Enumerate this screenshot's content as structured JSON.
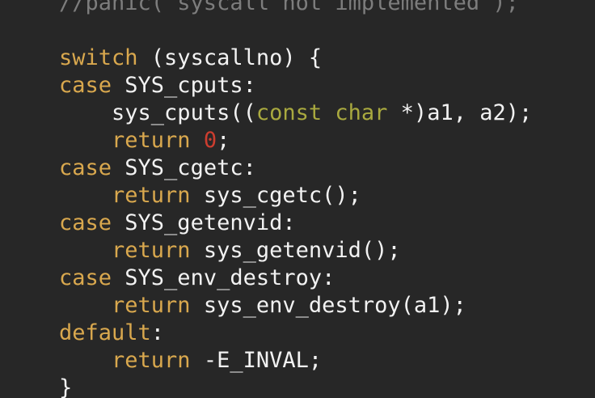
{
  "colors": {
    "background": "#272727",
    "keyword": "#d9a84e",
    "type": "#a9a93f",
    "number": "#cc3d2f",
    "comment": "#7d7d7d",
    "text": "#f2f2f2"
  },
  "code": {
    "lines": [
      {
        "indent": "",
        "tokens": [
          {
            "t": "cm",
            "v": "//panic(\"syscall not implemented\");"
          }
        ]
      },
      {
        "indent": "",
        "tokens": []
      },
      {
        "indent": "",
        "tokens": [
          {
            "t": "kw",
            "v": "switch"
          },
          {
            "t": "pl",
            "v": " (syscallno) {"
          }
        ]
      },
      {
        "indent": "",
        "tokens": [
          {
            "t": "kw",
            "v": "case"
          },
          {
            "t": "pl",
            "v": " SYS_cputs:"
          }
        ]
      },
      {
        "indent": "    ",
        "tokens": [
          {
            "t": "pl",
            "v": "sys_cputs(("
          },
          {
            "t": "type",
            "v": "const"
          },
          {
            "t": "pl",
            "v": " "
          },
          {
            "t": "type",
            "v": "char"
          },
          {
            "t": "pl",
            "v": " *)a1, a2);"
          }
        ]
      },
      {
        "indent": "    ",
        "tokens": [
          {
            "t": "kw",
            "v": "return"
          },
          {
            "t": "pl",
            "v": " "
          },
          {
            "t": "num",
            "v": "0"
          },
          {
            "t": "pl",
            "v": ";"
          }
        ]
      },
      {
        "indent": "",
        "tokens": [
          {
            "t": "kw",
            "v": "case"
          },
          {
            "t": "pl",
            "v": " SYS_cgetc:"
          }
        ]
      },
      {
        "indent": "    ",
        "tokens": [
          {
            "t": "kw",
            "v": "return"
          },
          {
            "t": "pl",
            "v": " sys_cgetc();"
          }
        ]
      },
      {
        "indent": "",
        "tokens": [
          {
            "t": "kw",
            "v": "case"
          },
          {
            "t": "pl",
            "v": " SYS_getenvid:"
          }
        ]
      },
      {
        "indent": "    ",
        "tokens": [
          {
            "t": "kw",
            "v": "return"
          },
          {
            "t": "pl",
            "v": " sys_getenvid();"
          }
        ]
      },
      {
        "indent": "",
        "tokens": [
          {
            "t": "kw",
            "v": "case"
          },
          {
            "t": "pl",
            "v": " SYS_env_destroy:"
          }
        ]
      },
      {
        "indent": "    ",
        "tokens": [
          {
            "t": "kw",
            "v": "return"
          },
          {
            "t": "pl",
            "v": " sys_env_destroy(a1);"
          }
        ]
      },
      {
        "indent": "",
        "tokens": [
          {
            "t": "kw",
            "v": "default"
          },
          {
            "t": "pl",
            "v": ":"
          }
        ]
      },
      {
        "indent": "    ",
        "tokens": [
          {
            "t": "kw",
            "v": "return"
          },
          {
            "t": "pl",
            "v": " -E_INVAL;"
          }
        ]
      },
      {
        "indent": "",
        "tokens": [
          {
            "t": "pl",
            "v": "}"
          }
        ]
      }
    ]
  }
}
